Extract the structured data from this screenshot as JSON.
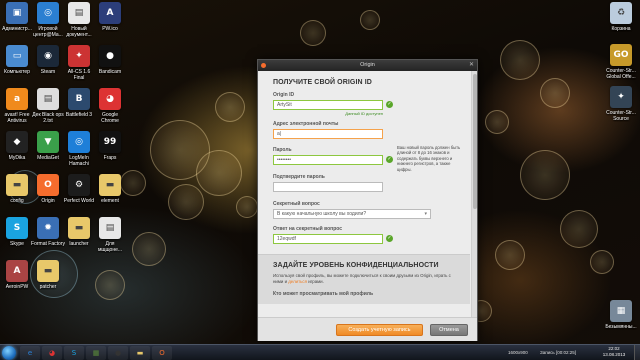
{
  "desktop": {
    "left_icons": [
      {
        "label": "Администр...",
        "icon": "computer-admin-icon",
        "color": "#3a6fb5",
        "glyph": "▣"
      },
      {
        "label": "Игровой центр@Ма...",
        "icon": "game-center-icon",
        "color": "#2b7fd1",
        "glyph": "◎"
      },
      {
        "label": "Новый документ...",
        "icon": "document-icon",
        "color": "#e8e8e8",
        "glyph": "▤"
      },
      {
        "label": "PW.ico",
        "icon": "pw-icon",
        "color": "#2c3e7a",
        "glyph": "A"
      },
      {
        "label": "Компьютер",
        "icon": "computer-icon",
        "color": "#4a8bd0",
        "glyph": "▭"
      },
      {
        "label": "Steam",
        "icon": "steam-icon",
        "color": "#1b2838",
        "glyph": "◉"
      },
      {
        "label": "All-CS 1.6 Final",
        "icon": "cs-icon",
        "color": "#c33",
        "glyph": "✦"
      },
      {
        "label": "Bandicam",
        "icon": "bandicam-icon",
        "color": "#111",
        "glyph": "●"
      },
      {
        "label": "avast! Free Antivirus",
        "icon": "avast-icon",
        "color": "#f08a1c",
        "glyph": "a"
      },
      {
        "label": "Дек Black ops 2.txt",
        "icon": "text-file-icon",
        "color": "#ddd",
        "glyph": "▤"
      },
      {
        "label": "Battlefield 3",
        "icon": "battlefield-icon",
        "color": "#2c4a6e",
        "glyph": "B"
      },
      {
        "label": "Google Chrome",
        "icon": "chrome-icon",
        "color": "#d33",
        "glyph": "◕"
      },
      {
        "label": "MyDika",
        "icon": "mydika-icon",
        "color": "#222",
        "glyph": "◆"
      },
      {
        "label": "MediaGet",
        "icon": "mediaget-icon",
        "color": "#3aa04a",
        "glyph": "▼"
      },
      {
        "label": "LogMeIn Hamachi",
        "icon": "hamachi-icon",
        "color": "#1e7fd8",
        "glyph": "◎"
      },
      {
        "label": "Fraps",
        "icon": "fraps-icon",
        "color": "#111",
        "glyph": "99"
      },
      {
        "label": "config",
        "icon": "folder-icon",
        "color": "#e8c86a",
        "glyph": "▬"
      },
      {
        "label": "Origin",
        "icon": "origin-icon",
        "color": "#f56c2d",
        "glyph": "O"
      },
      {
        "label": "Perfect World",
        "icon": "perfect-world-icon",
        "color": "#1c1c1c",
        "glyph": "⚙"
      },
      {
        "label": "element",
        "icon": "folder-icon",
        "color": "#e8c86a",
        "glyph": "▬"
      },
      {
        "label": "Skype",
        "icon": "skype-icon",
        "color": "#1aa3e0",
        "glyph": "S"
      },
      {
        "label": "Format Factory",
        "icon": "format-factory-icon",
        "color": "#3a6fb5",
        "glyph": "✹"
      },
      {
        "label": "launcher",
        "icon": "folder-icon",
        "color": "#e8c86a",
        "glyph": "▬"
      },
      {
        "label": "Для мщщоне...",
        "icon": "document-icon",
        "color": "#e8e8e8",
        "glyph": "▤"
      },
      {
        "label": "AeroinPW",
        "icon": "aeroin-icon",
        "color": "#a44",
        "glyph": "A"
      },
      {
        "label": "patcher",
        "icon": "folder-icon",
        "color": "#e8c86a",
        "glyph": "▬"
      }
    ],
    "right_icons": [
      {
        "label": "Корзина",
        "icon": "recycle-bin-icon",
        "color": "#bcd",
        "glyph": "♻"
      },
      {
        "label": "Counter-Str... Global Offe...",
        "icon": "csgo-icon",
        "color": "#c79a2a",
        "glyph": "GO"
      },
      {
        "label": "Counter-Str... Source",
        "icon": "cs-source-icon",
        "color": "#345",
        "glyph": "✦"
      },
      {
        "label": "Безымянны...",
        "icon": "image-file-icon",
        "color": "#789",
        "glyph": "▦"
      }
    ]
  },
  "window": {
    "title": "Origin",
    "close_glyph": "✕",
    "heading": "ПОЛУЧИТЕ СВОЙ ORIGIN ID",
    "origin_id": {
      "label": "Origin ID",
      "value": "ArtySit",
      "hint": "Данный ID доступен"
    },
    "email": {
      "label": "Адрес электронной почты",
      "value": "a|"
    },
    "password": {
      "label": "Пароль",
      "value": "••••••••",
      "hint": "Ваш новый пароль должен быть длиной от 8 до 16 знаков и содержать буквы верхнего и нижнего регистров, а также цифры."
    },
    "confirm_password": {
      "label": "Подтвердите пароль",
      "value": ""
    },
    "secret_question": {
      "label": "Секретный вопрос",
      "value": "В какую начальную школу вы ходили?"
    },
    "secret_answer": {
      "label": "Ответ на секретный вопрос",
      "value": "12eqwdf"
    },
    "privacy": {
      "heading": "ЗАДАЙТЕ УРОВЕНЬ КОНФИДЕНЦИАЛЬНОСТИ",
      "text_before": "Используя свой профиль, вы можете подключиться к своим друзьям из Origin, играть с ними и ",
      "link": "делиться",
      "text_after": " игрaми.",
      "question": "Кто может просматривать мой профиль"
    },
    "create_button": "Создать учетную запись",
    "cancel_button": "Отмена"
  },
  "taskbar": {
    "apps": [
      {
        "icon": "ie-icon",
        "color": "#2a7fd4",
        "glyph": "e"
      },
      {
        "icon": "chrome-taskbar-icon",
        "color": "#d33",
        "glyph": "◕"
      },
      {
        "icon": "skype-taskbar-icon",
        "color": "#1aa3e0",
        "glyph": "S"
      },
      {
        "icon": "minecraft-taskbar-icon",
        "color": "#5a8a3a",
        "glyph": "▦"
      },
      {
        "icon": "bandicam-taskbar-icon",
        "color": "#333",
        "glyph": "●"
      },
      {
        "icon": "folder-taskbar-icon",
        "color": "#e8c86a",
        "glyph": "▬"
      },
      {
        "icon": "origin-taskbar-icon",
        "color": "#f56c2d",
        "glyph": "O"
      }
    ],
    "resolution": "1600x900",
    "recording": "Запись [00:02:25]",
    "time": "22:02",
    "date": "13.08.2013"
  }
}
